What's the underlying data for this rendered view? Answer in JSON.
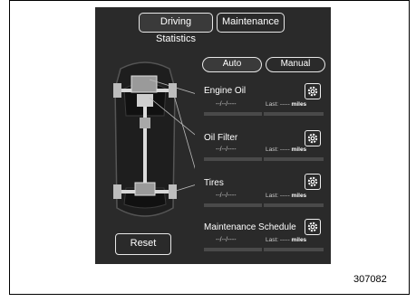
{
  "tabs": [
    {
      "label": "Driving Statistics",
      "active": true
    },
    {
      "label": "Maintenance",
      "active": false
    }
  ],
  "mode_toggle": {
    "auto_label": "Auto",
    "manual_label": "Manual",
    "selected": "Auto"
  },
  "items": [
    {
      "name": "Engine Oil",
      "date": "--/--/----",
      "last_prefix": "Last:",
      "last_value": "-----",
      "last_unit": "miles",
      "icon": "gear-icon"
    },
    {
      "name": "Oil Filter",
      "date": "--/--/----",
      "last_prefix": "Last:",
      "last_value": "-----",
      "last_unit": "miles",
      "icon": "gear-icon"
    },
    {
      "name": "Tires",
      "date": "--/--/----",
      "last_prefix": "Last:",
      "last_value": "-----",
      "last_unit": "miles",
      "icon": "gear-icon"
    },
    {
      "name": "Maintenance Schedule",
      "date": "--/--/----",
      "last_prefix": "Last:",
      "last_value": "-----",
      "last_unit": "miles",
      "icon": "gear-icon"
    }
  ],
  "reset_label": "Reset",
  "figure_number": "307082",
  "colors": {
    "screen_bg": "#2a2a2a",
    "outline": "#e8e8e8",
    "text": "#ffffff",
    "bar": "#4a4a4a"
  }
}
